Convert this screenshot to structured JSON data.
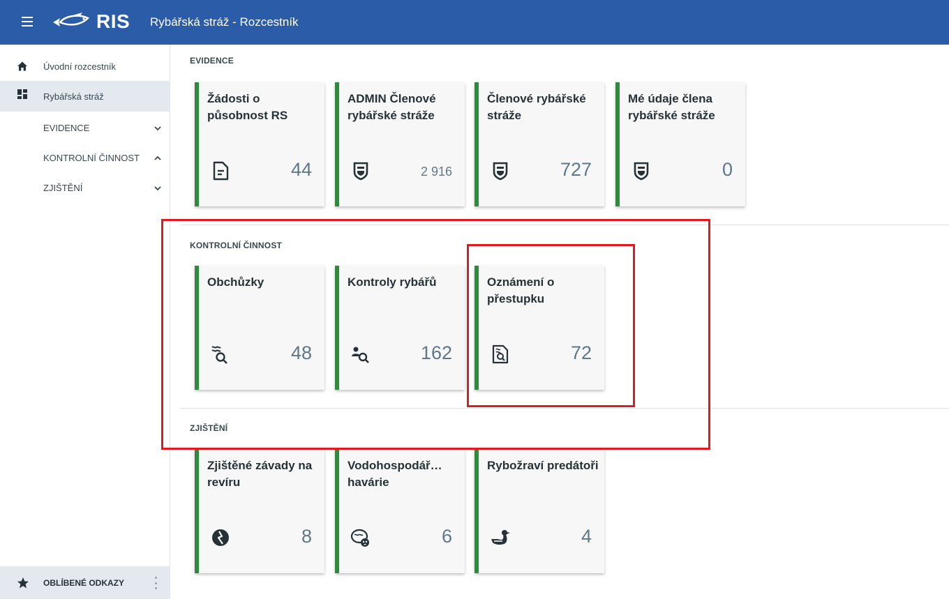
{
  "header": {
    "logo_text": "RIS",
    "title": "Rybářská stráž - Rozcestník"
  },
  "sidebar": {
    "items": [
      {
        "label": "Úvodní rozcestník",
        "icon": "home-icon"
      },
      {
        "label": "Rybářská stráž",
        "icon": "dashboard-icon",
        "active": true
      }
    ],
    "sub_items": [
      {
        "label": "EVIDENCE",
        "chevron": "down"
      },
      {
        "label": "KONTROLNÍ ČINNOST",
        "chevron": "up"
      },
      {
        "label": "ZJIŠTĚNÍ",
        "chevron": "down"
      }
    ],
    "favorites_label": "OBLÍBENÉ ODKAZY"
  },
  "sections": [
    {
      "title": "EVIDENCE",
      "cards": [
        {
          "title": "Žádosti o působnost RS",
          "count": "44",
          "icon": "document-icon"
        },
        {
          "title": "ADMIN Členové rybářské stráže",
          "count": "2 916",
          "icon": "shield-icon"
        },
        {
          "title": "Členové rybářské stráže",
          "count": "727",
          "icon": "shield-icon"
        },
        {
          "title": "Mé údaje člena rybářské stráže",
          "count": "0",
          "icon": "shield-icon"
        }
      ]
    },
    {
      "title": "KONTROLNÍ ČINNOST",
      "cards": [
        {
          "title": "Obchůzky",
          "count": "48",
          "icon": "water-search-icon"
        },
        {
          "title": "Kontroly rybářů",
          "count": "162",
          "icon": "person-search-icon"
        },
        {
          "title": "Oznámení o přestupku",
          "count": "72",
          "icon": "report-search-icon"
        }
      ]
    },
    {
      "title": "ZJIŠTĚNÍ",
      "cards": [
        {
          "title": "Zjištěné závady na revíru",
          "count": "8",
          "icon": "damage-icon"
        },
        {
          "title": "Vodohospodář… havárie",
          "count": "6",
          "icon": "pollution-icon"
        },
        {
          "title": "Rybožraví predátoři",
          "count": "4",
          "icon": "duck-icon"
        }
      ]
    }
  ],
  "colors": {
    "topbar": "#2b5ca8",
    "card_accent": "#2e8b3c",
    "highlight": "#e3191f",
    "count_text": "#5f7887"
  }
}
